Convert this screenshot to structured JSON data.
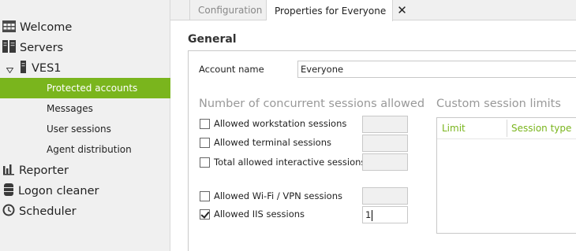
{
  "sidebar": {
    "items": [
      {
        "label": "Welcome",
        "icon": "grid-icon"
      },
      {
        "label": "Servers",
        "icon": "servers-icon"
      },
      {
        "label": "VES1",
        "icon": "server-icon",
        "expand_icon": "chevron-down-icon"
      },
      {
        "label": "Protected accounts",
        "active": true
      },
      {
        "label": "Messages"
      },
      {
        "label": "User sessions"
      },
      {
        "label": "Agent distribution"
      },
      {
        "label": "Reporter",
        "icon": "bar-chart-icon"
      },
      {
        "label": "Logon cleaner",
        "icon": "database-icon"
      },
      {
        "label": "Scheduler",
        "icon": "clock-icon"
      }
    ]
  },
  "tabs": [
    {
      "label": "Configuration",
      "active": false
    },
    {
      "label": "Properties for Everyone",
      "active": true,
      "close_glyph": "✕"
    }
  ],
  "main": {
    "section_title": "General",
    "account_name_label": "Account name",
    "account_name_value": "Everyone",
    "concurrent_heading": "Number of concurrent sessions allowed",
    "custom_heading": "Custom session limits",
    "options": [
      {
        "label": "Allowed workstation sessions",
        "checked": false,
        "value": ""
      },
      {
        "label": "Allowed terminal sessions",
        "checked": false,
        "value": ""
      },
      {
        "label": "Total allowed interactive sessions",
        "checked": false,
        "value": ""
      },
      {
        "label": "Allowed Wi-Fi / VPN sessions",
        "checked": false,
        "value": ""
      },
      {
        "label": "Allowed IIS sessions",
        "checked": true,
        "value": "1"
      }
    ],
    "limits_table": {
      "columns": [
        "Limit",
        "Session type"
      ]
    }
  },
  "colors": {
    "accent": "#7ab51d",
    "sidebar_bg": "#f0f0f0",
    "disabled_text": "#999999"
  }
}
